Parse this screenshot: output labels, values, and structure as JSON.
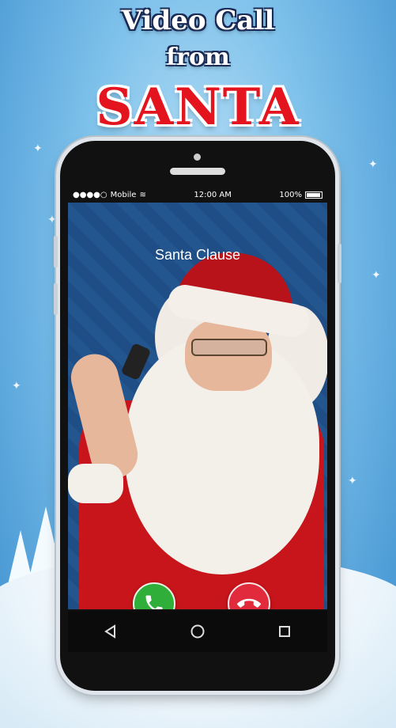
{
  "banner": {
    "line1": "Video Call",
    "line2": "from",
    "line3": "SANTA"
  },
  "status_bar": {
    "carrier": "Mobile",
    "time": "12:00 AM",
    "battery": "100%"
  },
  "call": {
    "caller_name": "Santa Clause"
  },
  "icons": {
    "accept": "phone-answer-icon",
    "decline": "phone-hangup-icon",
    "back": "back-triangle-icon",
    "home": "home-circle-icon",
    "recents": "recents-square-icon"
  },
  "colors": {
    "accept": "#2fae3a",
    "decline": "#e12b3d",
    "title_red": "#e3141d",
    "background_blue": "#7cc0ea"
  }
}
